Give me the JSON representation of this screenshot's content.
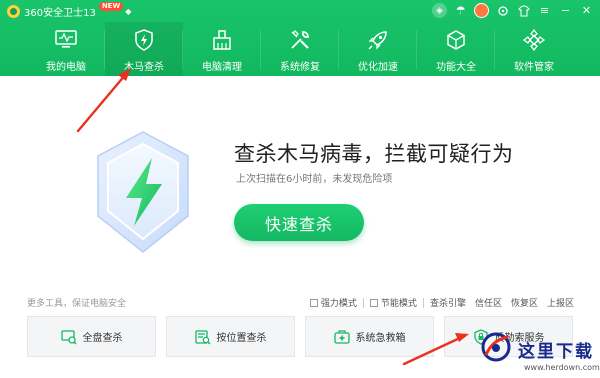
{
  "titlebar": {
    "app_title": "360安全卫士13",
    "badge": "NEW",
    "icons": [
      "shield-status-icon",
      "umbrella-icon",
      "avatar-icon",
      "skin-icon",
      "shirt-icon",
      "menu-icon",
      "minimize-icon",
      "close-icon"
    ]
  },
  "nav": {
    "items": [
      {
        "label": "我的电脑",
        "icon": "monitor-icon"
      },
      {
        "label": "木马查杀",
        "icon": "shield-bolt-icon",
        "active": true
      },
      {
        "label": "电脑清理",
        "icon": "broom-icon"
      },
      {
        "label": "系统修复",
        "icon": "wrench-icon"
      },
      {
        "label": "优化加速",
        "icon": "rocket-icon"
      },
      {
        "label": "功能大全",
        "icon": "cube-icon"
      },
      {
        "label": "软件管家",
        "icon": "flower-icon"
      }
    ]
  },
  "hero": {
    "title": "查杀木马病毒，拦截可疑行为",
    "subtitle": "上次扫描在6小时前，未发现危险项",
    "scan_button": "快速查杀"
  },
  "tools_bar": {
    "label": "更多工具，保证电脑安全",
    "options": [
      {
        "label": "强力模式"
      },
      {
        "label": "节能模式"
      }
    ],
    "links": [
      "查杀引擎",
      "信任区",
      "恢复区",
      "上报区"
    ]
  },
  "tools": [
    {
      "label": "全盘查杀",
      "icon": "full-scan-icon"
    },
    {
      "label": "按位置查杀",
      "icon": "location-scan-icon"
    },
    {
      "label": "系统急救箱",
      "icon": "first-aid-icon"
    },
    {
      "label": "反勒索服务",
      "icon": "anti-ransom-icon"
    }
  ],
  "watermark": {
    "text": "这里下载",
    "url": "www.herdown.com"
  },
  "colors": {
    "brand_green": "#14b862",
    "arrow_red": "#e8321f"
  }
}
